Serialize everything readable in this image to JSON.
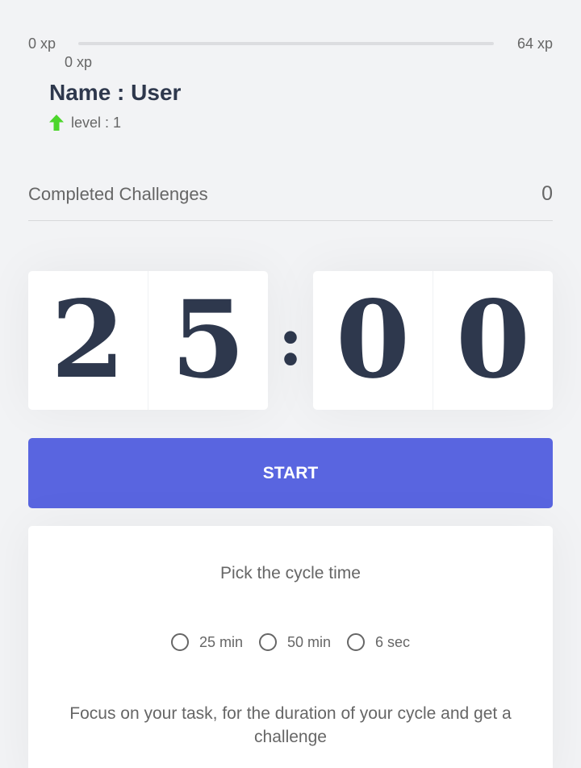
{
  "xp": {
    "min_label": "0 xp",
    "max_label": "64 xp",
    "current_label": "0 xp",
    "progress_fraction": 0.0
  },
  "profile": {
    "name": "Name : User",
    "level": "level : 1",
    "level_icon": "level-up-arrow-icon"
  },
  "completed": {
    "label": "Completed Challenges",
    "count": "0"
  },
  "countdown": {
    "minutes_left": "2",
    "minutes_right": "5",
    "separator": ":",
    "seconds_left": "0",
    "seconds_right": "0"
  },
  "start_button": {
    "label": "START"
  },
  "cycle": {
    "title": "Pick the cycle time",
    "options": [
      {
        "label": "25 min"
      },
      {
        "label": "50 min"
      },
      {
        "label": "6 sec"
      }
    ],
    "description": "Focus on your task, for the duration of your cycle and get a challenge"
  },
  "colors": {
    "accent": "#5965e0",
    "level_green": "#4cd62b",
    "text": "#666666",
    "title": "#2e384d",
    "background": "#f2f3f5"
  }
}
